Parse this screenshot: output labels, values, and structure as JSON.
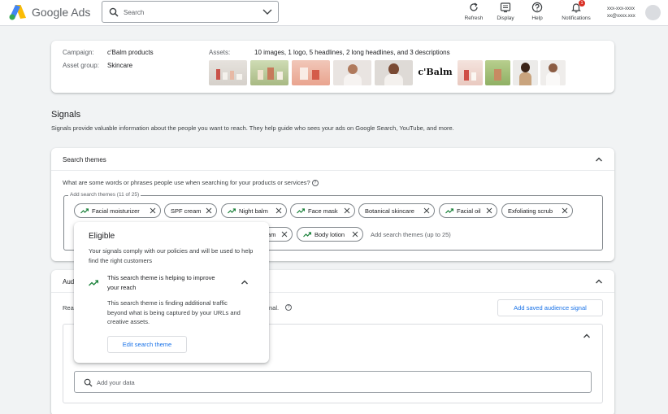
{
  "header": {
    "brand": "Google Ads",
    "search_placeholder": "Search",
    "tools": [
      {
        "label": "Refresh",
        "icon": "refresh-icon"
      },
      {
        "label": "Display",
        "icon": "display-icon"
      },
      {
        "label": "Help",
        "icon": "help-icon"
      },
      {
        "label": "Notifications",
        "icon": "bell-icon",
        "badge": "1"
      }
    ],
    "account": {
      "id": "xxx-xxx-xxxx",
      "email": "xx@xxxx.xxx"
    }
  },
  "campaign": {
    "campaign_label": "Campaign:",
    "campaign_value": "c'Balm products",
    "group_label": "Asset group:",
    "group_value": "Skincare",
    "assets_label": "Assets:",
    "assets_value": "10 images, 1 logo, 5 headlines, 2 long headlines, and 3 descriptions",
    "logo_text": "c'Balm"
  },
  "signals": {
    "title": "Signals",
    "description": "Signals provide valuable information about the people you want to reach. They help guide who sees your ads on Google Search, YouTube, and more."
  },
  "search_themes": {
    "title": "Search themes",
    "question": "What are some words or phrases people use when searching for your products or services?",
    "field_label": "Add search themes (11 of 25)",
    "chips": [
      "Facial moisturizer",
      "SPF cream",
      "Night balm",
      "Face mask",
      "Botanical skincare",
      "Facial oil",
      "Exfoliating scrub",
      "am",
      "Body lotion"
    ],
    "add_placeholder": "Add search themes (up to 25)"
  },
  "audience": {
    "title_partial": "Aud",
    "text_partial": "Rea",
    "text_tail": "nal.",
    "add_button": "Add saved audience signal",
    "data_placeholder": "Add your data"
  },
  "popover": {
    "title": "Eligible",
    "body": "Your signals comply with our policies and will be used to help find the right customers",
    "sub_title": "This search theme is helping to improve your reach",
    "detail": "This search theme is finding additional traffic beyond what is being captured by your URLs and creative assets.",
    "button": "Edit search theme"
  },
  "colors": {
    "accent": "#1a73e8",
    "trend": "#188038",
    "badge": "#d93025"
  }
}
